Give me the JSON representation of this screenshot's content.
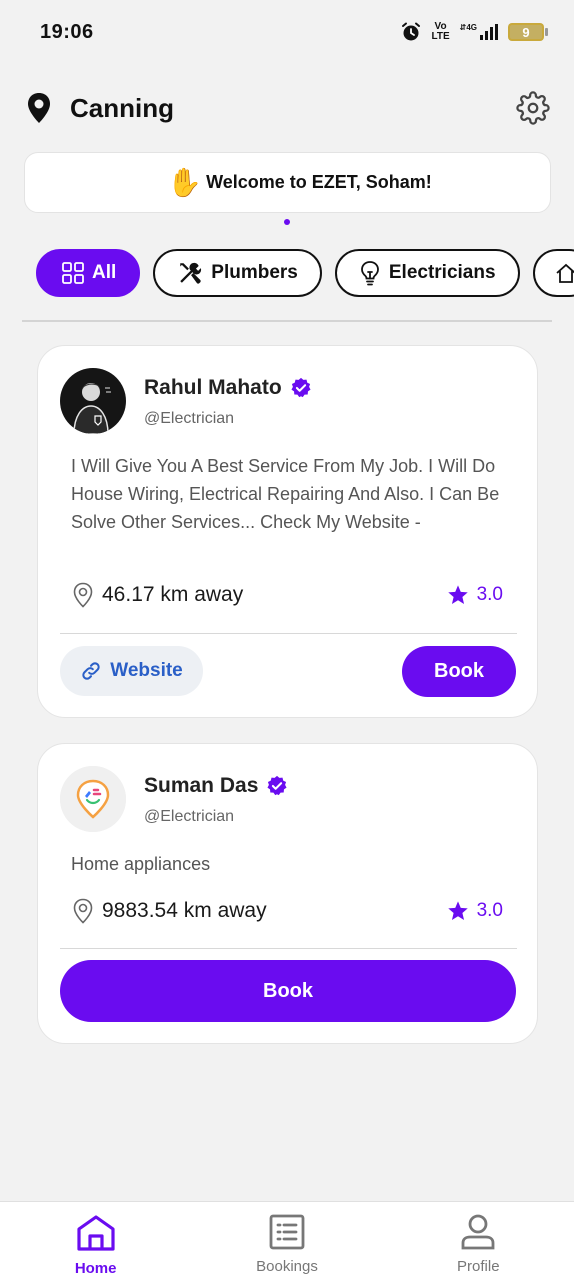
{
  "status_bar": {
    "time": "19:06",
    "volte_top": "Vo",
    "volte_bottom": "LTE",
    "network": "4G",
    "battery": "9"
  },
  "header": {
    "location": "Canning",
    "location_icon": "pin-icon",
    "settings_icon": "gear-icon"
  },
  "welcome": {
    "emoji": "✋",
    "text": "Welcome to EZET, Soham!"
  },
  "categories": [
    {
      "label": "All",
      "icon": "grid-icon",
      "active": true
    },
    {
      "label": "Plumbers",
      "icon": "tools-icon",
      "active": false
    },
    {
      "label": "Electricians",
      "icon": "bulb-icon",
      "active": false
    }
  ],
  "providers": [
    {
      "name": "Rahul Mahato",
      "handle": "@Electrician",
      "description": "I Will Give You A Best Service From My Job. I Will Do House Wiring, Electrical Repairing And Also. I Can Be Solve Other Services... Check My Website -",
      "distance": "46.17 km away",
      "rating": "3.0",
      "website_label": "Website",
      "book_label": "Book"
    },
    {
      "name": "Suman Das",
      "handle": "@Electrician",
      "description": "Home appliances",
      "distance": "9883.54 km away",
      "rating": "3.0",
      "book_label": "Book"
    }
  ],
  "nav": [
    {
      "label": "Home",
      "icon": "home-icon",
      "active": true
    },
    {
      "label": "Bookings",
      "icon": "list-icon",
      "active": false
    },
    {
      "label": "Profile",
      "icon": "user-icon",
      "active": false
    }
  ],
  "colors": {
    "accent": "#6a0cf0",
    "link": "#2a5fc7",
    "background": "#f2f2f2"
  }
}
